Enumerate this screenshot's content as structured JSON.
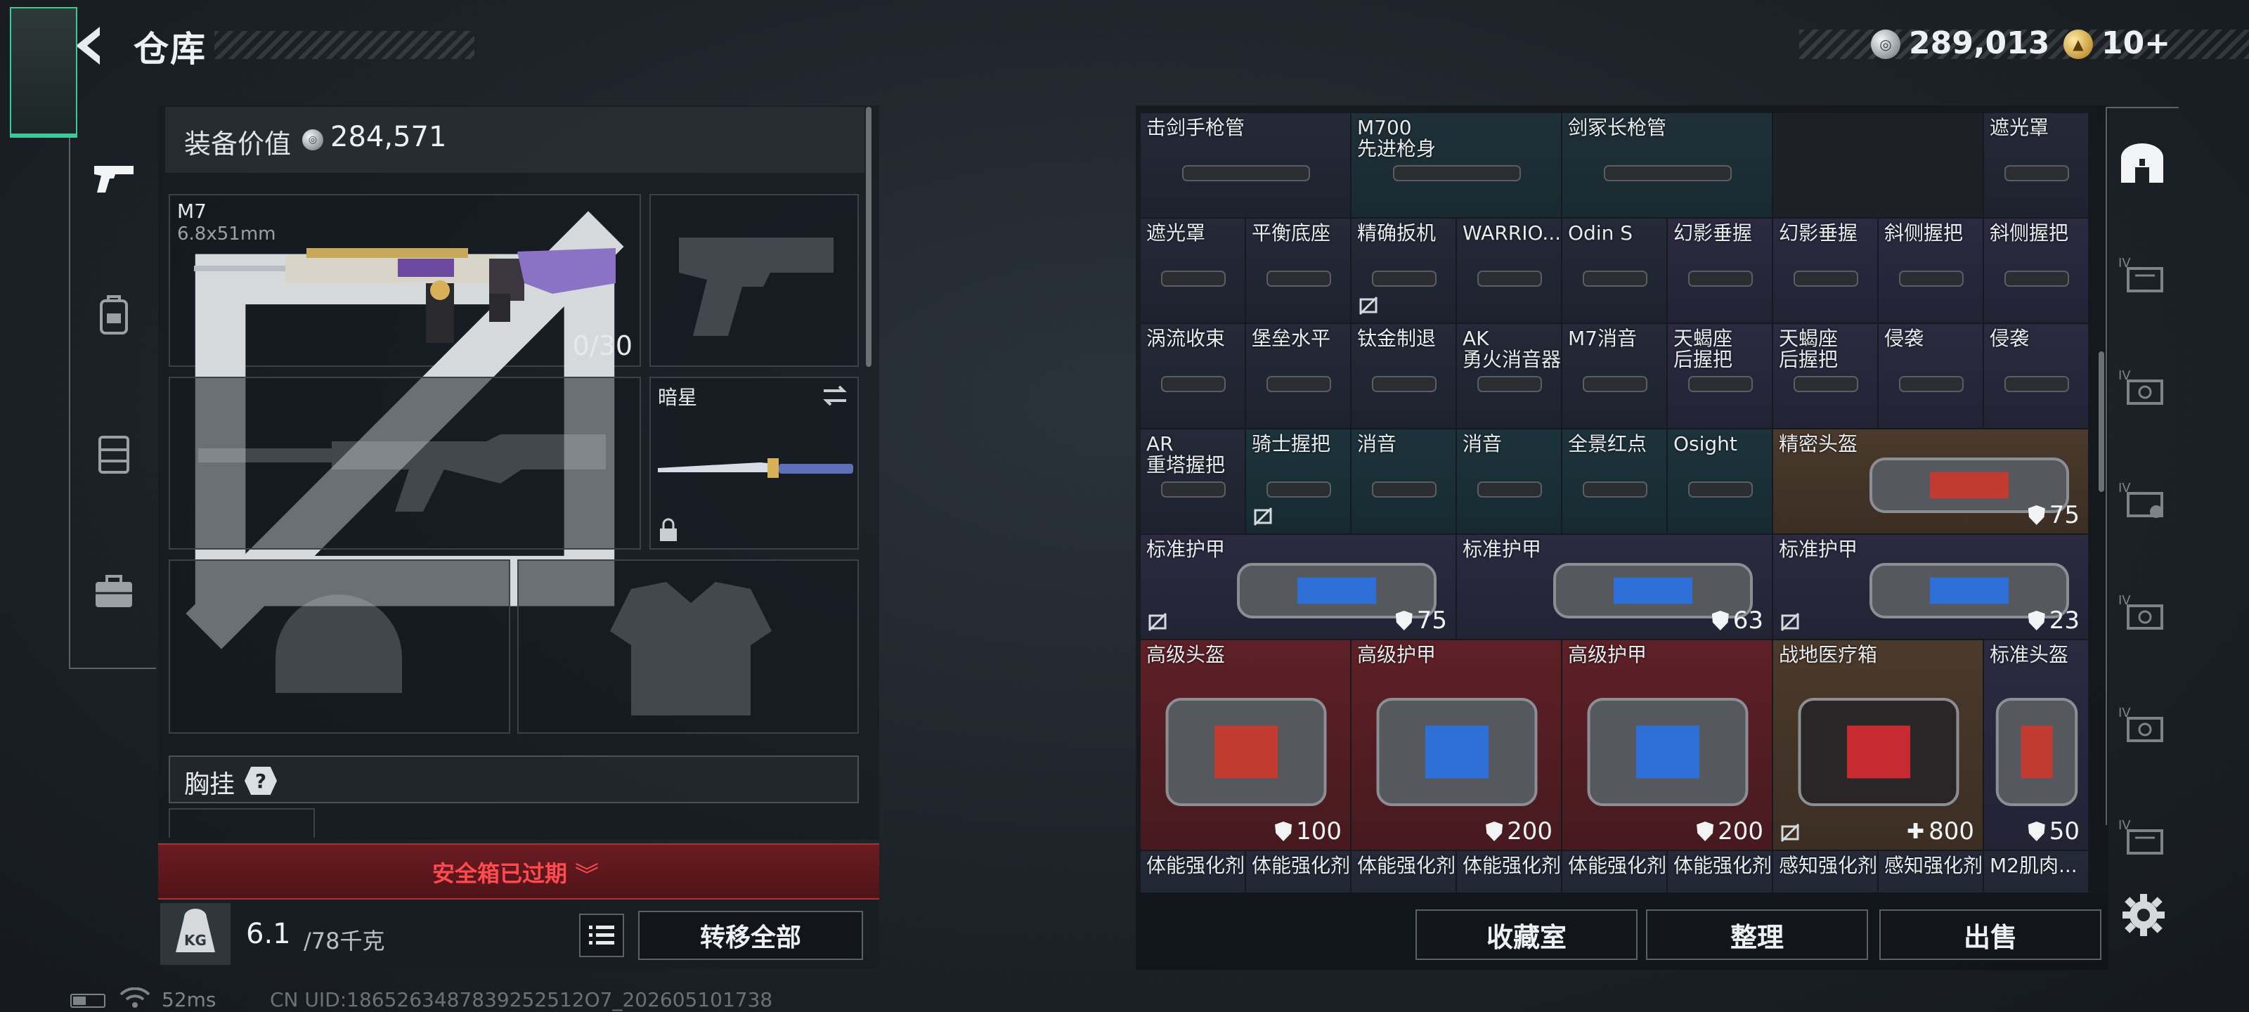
{
  "header": {
    "title": "仓库",
    "back_icon": "back-arrow-icon"
  },
  "currency": {
    "silver": "289,013",
    "gold": "10+"
  },
  "left_sidebar": {
    "tabs": [
      {
        "icon": "pistol-icon",
        "active": true
      },
      {
        "icon": "backpack-icon",
        "active": false
      },
      {
        "icon": "vest-icon",
        "active": false
      },
      {
        "icon": "briefcase-icon",
        "active": false
      }
    ]
  },
  "equipment": {
    "value_label": "装备价值",
    "value": "284,571",
    "primary": {
      "name": "M7",
      "ammo_type": "6.8x51mm",
      "ammo": "0/30"
    },
    "melee": {
      "name": "暗星"
    },
    "chest_rig": {
      "label": "胸挂",
      "help": "?"
    }
  },
  "safe_box": {
    "label": "安全箱已过期",
    "chevron": "︾"
  },
  "weight": {
    "current": "6.1",
    "max": "/78千克",
    "kg_label": "KG"
  },
  "buttons": {
    "transfer_all": "转移全部",
    "collection": "收藏室",
    "sort": "整理",
    "sell": "出售"
  },
  "status": {
    "ping": "52ms",
    "uid": "CN UID:1865263487839252512O7_202605101738"
  },
  "stash": [
    {
      "label": "击剑手枪管",
      "bg": "dark"
    },
    {
      "label": "M700\n先进枪身",
      "bg": "blue"
    },
    {
      "label": "剑冢长枪管",
      "bg": "blue"
    },
    {
      "label": "",
      "bg": "none"
    },
    {
      "label": "遮光罩",
      "bg": "dark"
    },
    {
      "label": "遮光罩",
      "bg": "dark"
    },
    {
      "label": "平衡底座",
      "bg": "dark"
    },
    {
      "label": "精确扳机",
      "bg": "dark",
      "locked": true
    },
    {
      "label": "WARRIO...",
      "bg": "dark"
    },
    {
      "label": "Odin S",
      "bg": "dark"
    },
    {
      "label": "幻影垂握",
      "bg": "purp"
    },
    {
      "label": "幻影垂握",
      "bg": "purp"
    },
    {
      "label": "斜侧握把",
      "bg": "purp"
    },
    {
      "label": "斜侧握把",
      "bg": "purp"
    },
    {
      "label": "涡流收束",
      "bg": "dark"
    },
    {
      "label": "堡垒水平",
      "bg": "dark"
    },
    {
      "label": "钛金制退",
      "bg": "dark"
    },
    {
      "label": "AK\n勇火消音器",
      "bg": "dark"
    },
    {
      "label": "M7消音",
      "bg": "dark"
    },
    {
      "label": "天蝎座\n后握把",
      "bg": "purp"
    },
    {
      "label": "天蝎座\n后握把",
      "bg": "purp"
    },
    {
      "label": "侵袭",
      "bg": "purp"
    },
    {
      "label": "侵袭",
      "bg": "purp"
    },
    {
      "label": "AR\n重塔握把",
      "bg": "dark"
    },
    {
      "label": "骑士握把",
      "bg": "teal",
      "locked": true
    },
    {
      "label": "消音",
      "bg": "teal"
    },
    {
      "label": "消音",
      "bg": "teal"
    },
    {
      "label": "全景红点",
      "bg": "teal"
    },
    {
      "label": "Osight",
      "bg": "teal"
    },
    {
      "label": "精密头盔",
      "bg": "gold",
      "val": "75",
      "val_icon": "shield"
    },
    {
      "label": "标准护甲",
      "bg": "purp",
      "val": "75",
      "val_icon": "shield",
      "locked": true
    },
    {
      "label": "标准护甲",
      "bg": "purp",
      "val": "63",
      "val_icon": "shield"
    },
    {
      "label": "标准护甲",
      "bg": "purp",
      "val": "23",
      "val_icon": "shield",
      "locked": true
    },
    {
      "label": "高级头盔",
      "bg": "red",
      "val": "100",
      "val_icon": "shield"
    },
    {
      "label": "高级护甲",
      "bg": "red",
      "val": "200",
      "val_icon": "shield"
    },
    {
      "label": "高级护甲",
      "bg": "red",
      "val": "200",
      "val_icon": "shield"
    },
    {
      "label": "战地医疗箱",
      "bg": "gold",
      "val": "800",
      "val_icon": "plus",
      "locked": true
    },
    {
      "label": "标准头盔",
      "bg": "purp",
      "val": "50",
      "val_icon": "shield"
    },
    {
      "label": "体能强化剂",
      "bg": "dark"
    },
    {
      "label": "体能强化剂",
      "bg": "dark"
    },
    {
      "label": "体能强化剂",
      "bg": "dark"
    },
    {
      "label": "体能强化剂",
      "bg": "dark"
    },
    {
      "label": "体能强化剂",
      "bg": "dark"
    },
    {
      "label": "体能强化剂",
      "bg": "dark"
    },
    {
      "label": "感知强化剂",
      "bg": "dark"
    },
    {
      "label": "感知强化剂",
      "bg": "dark"
    },
    {
      "label": "M2肌肉...",
      "bg": "dark"
    }
  ],
  "right_sidebar": {
    "icons": [
      "container-tab-icon",
      "tier-iv-case-icon",
      "tier-iv-case-icon",
      "tier-iv-case-icon",
      "tier-iv-case-icon",
      "tier-iv-case-icon",
      "tier-iv-case-icon",
      "settings-gear-icon"
    ]
  }
}
